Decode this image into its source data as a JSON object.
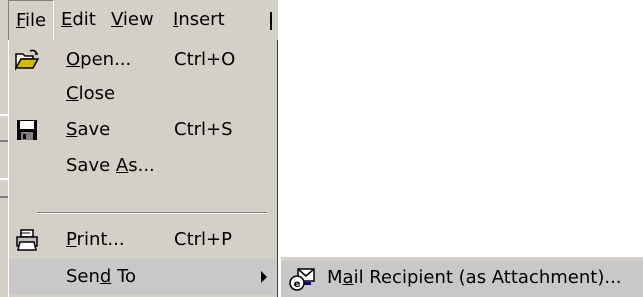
{
  "menubar": {
    "items": [
      {
        "mnemonic": "F",
        "rest": "ile"
      },
      {
        "mnemonic": "E",
        "rest": "dit"
      },
      {
        "mnemonic": "V",
        "rest": "iew"
      },
      {
        "mnemonic": "I",
        "rest": "nsert"
      }
    ]
  },
  "file_menu": {
    "open": {
      "pre": "",
      "mnemonic": "O",
      "post": "pen...",
      "shortcut": "Ctrl+O",
      "icon": "open-folder-icon"
    },
    "close": {
      "pre": "",
      "mnemonic": "C",
      "post": "lose"
    },
    "save": {
      "pre": "",
      "mnemonic": "S",
      "post": "ave",
      "shortcut": "Ctrl+S",
      "icon": "floppy-disk-icon"
    },
    "save_as": {
      "pre": "Save ",
      "mnemonic": "A",
      "post": "s..."
    },
    "print": {
      "pre": "",
      "mnemonic": "P",
      "post": "rint...",
      "shortcut": "Ctrl+P",
      "icon": "printer-icon"
    },
    "send_to": {
      "pre": "Sen",
      "mnemonic": "d",
      "post": " To"
    }
  },
  "send_to_menu": {
    "mail_recipient": {
      "pre": "M",
      "mnemonic": "a",
      "post": "il Recipient (as Attachment)...",
      "icon": "mail-envelope-icon"
    }
  },
  "colors": {
    "menu_face": "#d4d0c8",
    "highlight": "#c8c8c8"
  }
}
